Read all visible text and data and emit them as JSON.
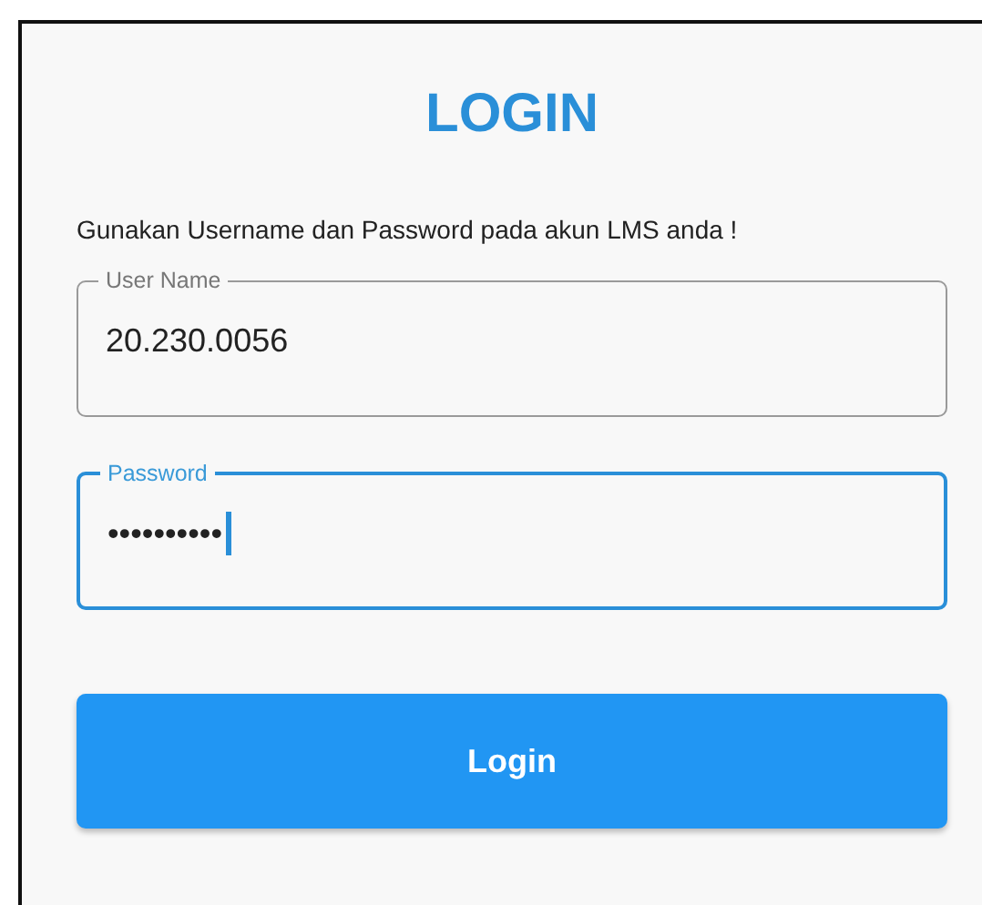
{
  "title": "LOGIN",
  "instruction": "Gunakan Username dan Password pada akun LMS anda !",
  "fields": [
    {
      "label": "User Name",
      "value": "20.230.0056",
      "focused": false
    },
    {
      "label": "Password",
      "value": "••••••••••",
      "focused": true
    }
  ],
  "button": "Login"
}
